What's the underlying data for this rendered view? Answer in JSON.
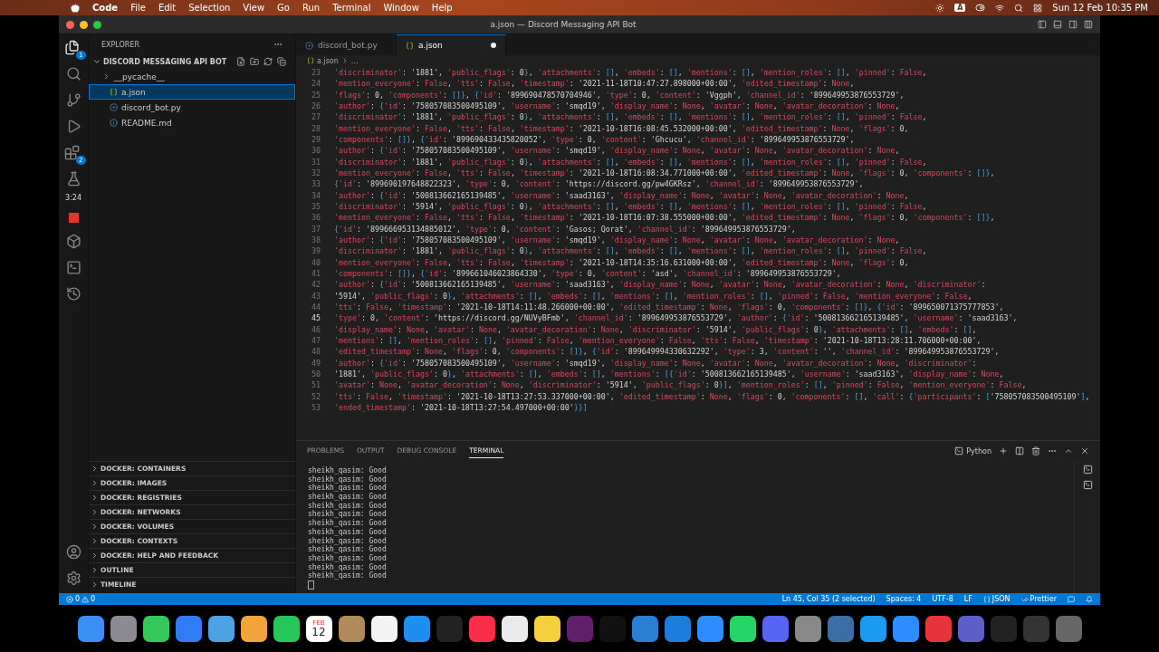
{
  "menu_bar": {
    "app": "Code",
    "items": [
      "File",
      "Edit",
      "Selection",
      "View",
      "Go",
      "Run",
      "Terminal",
      "Window",
      "Help"
    ],
    "input_source": "A",
    "clock": "Sun 12 Feb 10:35 PM"
  },
  "window": {
    "title": "a.json — Discord Messaging API Bot"
  },
  "activity_bar": {
    "badges": {
      "explorer": "1",
      "extensions": "2"
    },
    "timer": "3:24"
  },
  "sidebar": {
    "title": "EXPLORER",
    "project": "DISCORD MESSAGING API BOT",
    "tree": [
      {
        "label": "__pycache__",
        "kind": "folder",
        "selected": false
      },
      {
        "label": "a.json",
        "kind": "json",
        "selected": true
      },
      {
        "label": "discord_bot.py",
        "kind": "python",
        "selected": false
      },
      {
        "label": "README.md",
        "kind": "info",
        "selected": false
      }
    ],
    "sections": [
      "DOCKER: CONTAINERS",
      "DOCKER: IMAGES",
      "DOCKER: REGISTRIES",
      "DOCKER: NETWORKS",
      "DOCKER: VOLUMES",
      "DOCKER: CONTEXTS",
      "DOCKER: HELP AND FEEDBACK",
      "OUTLINE",
      "TIMELINE"
    ]
  },
  "tabs": [
    {
      "label": "discord_bot.py",
      "kind": "python",
      "selected": false,
      "modified": false
    },
    {
      "label": "a.json",
      "kind": "json",
      "selected": true,
      "modified": true
    }
  ],
  "breadcrumb": [
    "a.json",
    "..."
  ],
  "code": [
    {
      "n": "23",
      "current": false,
      "text": "'discriminator': '1881', 'public_flags': 0}, 'attachments': [], 'embeds': [], 'mentions': [], 'mention_roles': [], 'pinned': False,"
    },
    {
      "n": "24",
      "current": false,
      "text": "'mention_everyone': False, 'tts': False, 'timestamp': '2021-11-18T10:47:27.898000+00:00', 'edited_timestamp': None,"
    },
    {
      "n": "25",
      "current": false,
      "text": "'flags': 0, 'components': []}, {'id': '899690478570704946', 'type': 0, 'content': 'Vggph', 'channel_id': '899649953876553729',"
    },
    {
      "n": "26",
      "current": false,
      "text": "'author': {'id': '758057083500495109', 'username': 'smqd19', 'display_name': None, 'avatar': None, 'avatar_decoration': None,"
    },
    {
      "n": "27",
      "current": false,
      "text": "'discriminator': '1881', 'public_flags': 0}, 'attachments': [], 'embeds': [], 'mentions': [], 'mention_roles': [], 'pinned': False,"
    },
    {
      "n": "28",
      "current": false,
      "text": "'mention_everyone': False, 'tts': False, 'timestamp': '2021-10-18T16:08:45.532000+00:00', 'edited_timestamp': None, 'flags': 0,"
    },
    {
      "n": "29",
      "current": false,
      "text": "'components': []}, {'id': '899690433435820052', 'type': 0, 'content': 'Ghcucu', 'channel_id': '899649953876553729',"
    },
    {
      "n": "30",
      "current": false,
      "text": "'author': {'id': '758057083500495109', 'username': 'smqd19', 'display_name': None, 'avatar': None, 'avatar_decoration': None,"
    },
    {
      "n": "31",
      "current": false,
      "text": "'discriminator': '1881', 'public_flags': 0}, 'attachments': [], 'embeds': [], 'mentions': [], 'mention_roles': [], 'pinned': False,"
    },
    {
      "n": "32",
      "current": false,
      "text": "'mention_everyone': False, 'tts': False, 'timestamp': '2021-10-18T16:08:34.771000+00:00', 'edited_timestamp': None, 'flags': 0, 'components': []},"
    },
    {
      "n": "33",
      "current": false,
      "text": "{'id': '899690197648822323', 'type': 0, 'content': 'https://discord.gg/pw4GKRsz', 'channel_id': '899649953876553729',"
    },
    {
      "n": "34",
      "current": false,
      "text": "'author': {'id': '500813662165139485', 'username': 'saad3163', 'display_name': None, 'avatar': None, 'avatar_decoration': None,"
    },
    {
      "n": "35",
      "current": false,
      "text": "'discriminator': '5914', 'public_flags': 0}, 'attachments': [], 'embeds': [], 'mentions': [], 'mention_roles': [], 'pinned': False,"
    },
    {
      "n": "36",
      "current": false,
      "text": "'mention_everyone': False, 'tts': False, 'timestamp': '2021-10-18T16:07:38.555000+00:00', 'edited_timestamp': None, 'flags': 0, 'components': []},"
    },
    {
      "n": "37",
      "current": false,
      "text": "{'id': '899666953134885012', 'type': 0, 'content': 'Gasos; Qorat', 'channel_id': '899649953876553729',"
    },
    {
      "n": "38",
      "current": false,
      "text": "'author': {'id': '758057083500495109', 'username': 'smqd19', 'display_name': None, 'avatar': None, 'avatar_decoration': None,"
    },
    {
      "n": "39",
      "current": false,
      "text": "'discriminator': '1881', 'public_flags': 0}, 'attachments': [], 'embeds': [], 'mentions': [], 'mention_roles': [], 'pinned': False,"
    },
    {
      "n": "40",
      "current": false,
      "text": "'mention_everyone': False, 'tts': False, 'timestamp': '2021-10-18T14:35:16.631000+00:00', 'edited_timestamp': None, 'flags': 0,"
    },
    {
      "n": "41",
      "current": false,
      "text": "'components': []}, {'id': '899661046023864330', 'type': 0, 'content': 'asd', 'channel_id': '899649953876553729',"
    },
    {
      "n": "42",
      "current": false,
      "text": "'author': {'id': '500813662165139485', 'username': 'saad3163', 'display_name': None, 'avatar': None, 'avatar_decoration': None, 'discriminator':"
    },
    {
      "n": "43",
      "current": false,
      "text": "'5914', 'public_flags': 0}, 'attachments': [], 'embeds': [], 'mentions': [], 'mention_roles': [], 'pinned': False, 'mention_everyone': False,"
    },
    {
      "n": "44",
      "current": false,
      "text": "'tts': False, 'timestamp': '2021-10-18T14:11:48.266000+00:00', 'edited_timestamp': None, 'flags': 0, 'components': []}, {'id': '899650071375777853',"
    },
    {
      "n": "45",
      "current": true,
      "text": "'type': 0, 'content': 'https://discord.gg/NUVyBFmb', 'channel_id': '899649953876553729', 'author': {'id': '500813662165139485', 'username': 'saad3163',"
    },
    {
      "n": "46",
      "current": false,
      "text": "'display_name': None, 'avatar': None, 'avatar_decoration': None, 'discriminator': '5914', 'public_flags': 0}, 'attachments': [], 'embeds': [],"
    },
    {
      "n": "47",
      "current": false,
      "text": "'mentions': [], 'mention_roles': [], 'pinned': False, 'mention_everyone': False, 'tts': False, 'timestamp': '2021-10-18T13:28:11.706000+00:00',"
    },
    {
      "n": "48",
      "current": false,
      "text": "'edited_timestamp': None, 'flags': 0, 'components': []}, {'id': '899649994330632292', 'type': 3, 'content': '', 'channel_id': '899649953876553729',"
    },
    {
      "n": "49",
      "current": false,
      "text": "'author': {'id': '758057083500495109', 'username': 'smqd19', 'display_name': None, 'avatar': None, 'avatar_decoration': None, 'discriminator':"
    },
    {
      "n": "50",
      "current": false,
      "text": "'1881', 'public_flags': 0}, 'attachments': [], 'embeds': [], 'mentions': [{'id': '500813662165139485', 'username': 'saad3163', 'display_name': None,"
    },
    {
      "n": "51",
      "current": false,
      "text": "'avatar': None, 'avatar_decoration': None, 'discriminator': '5914', 'public_flags': 0}], 'mention_roles': [], 'pinned': False, 'mention_everyone': False,"
    },
    {
      "n": "52",
      "current": false,
      "text": "'tts': False, 'timestamp': '2021-10-18T13:27:53.337000+00:00', 'edited_timestamp': None, 'flags': 0, 'components': [], 'call': {'participants': ['758057083500495109'],"
    },
    {
      "n": "53",
      "current": false,
      "text": "'ended_timestamp': '2021-10-18T13:27:54.497000+00:00'}}]"
    }
  ],
  "panel": {
    "tabs": [
      {
        "label": "PROBLEMS",
        "selected": false
      },
      {
        "label": "OUTPUT",
        "selected": false
      },
      {
        "label": "DEBUG CONSOLE",
        "selected": false
      },
      {
        "label": "TERMINAL",
        "selected": true
      }
    ],
    "shell": "Python",
    "terminal_lines": [
      "sheikh_qasim: Good",
      "sheikh_qasim: Good",
      "sheikh_qasim: Good",
      "sheikh_qasim: Good",
      "sheikh_qasim: Good",
      "sheikh_qasim: Good",
      "sheikh_qasim: Good",
      "sheikh_qasim: Good",
      "sheikh_qasim: Good",
      "sheikh_qasim: Good",
      "sheikh_qasim: Good",
      "sheikh_qasim: Good",
      "sheikh_qasim: Good"
    ]
  },
  "status_bar": {
    "errors": "0",
    "warnings": "0",
    "right": [
      "Ln 45, Col 35 (2 selected)",
      "Spaces: 4",
      "UTF-8",
      "LF"
    ],
    "language": "JSON",
    "formatter": "Prettier"
  },
  "dock": {
    "calendar_month": "FEB",
    "calendar_day": "12"
  }
}
